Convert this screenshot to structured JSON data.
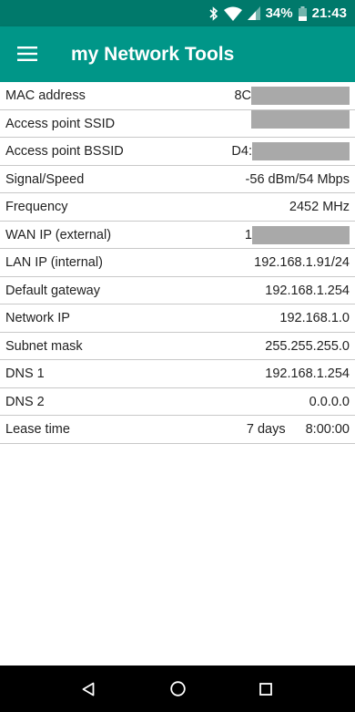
{
  "status_bar": {
    "battery": "34%",
    "time": "21:43",
    "icons": [
      "bluetooth-icon",
      "wifi-icon",
      "cell-signal-icon",
      "battery-icon"
    ]
  },
  "app_bar": {
    "title": "my Network Tools",
    "menu_icon": "hamburger-menu-icon"
  },
  "rows": [
    {
      "label": "MAC address",
      "value": "8C",
      "redacted": true
    },
    {
      "label": "Access point SSID",
      "value": "",
      "redacted": true
    },
    {
      "label": "Access point BSSID",
      "value": "D4:",
      "redacted": true
    },
    {
      "label": "Signal/Speed",
      "value": "-56 dBm/54 Mbps"
    },
    {
      "label": "Frequency",
      "value": "2452 MHz"
    },
    {
      "label": "WAN IP (external)",
      "value": "1",
      "redacted": true
    },
    {
      "label": "LAN IP (internal)",
      "value": "192.168.1.91/24"
    },
    {
      "label": "Default gateway",
      "value": "192.168.1.254"
    },
    {
      "label": "Network IP",
      "value": "192.168.1.0"
    },
    {
      "label": "Subnet mask",
      "value": "255.255.255.0"
    },
    {
      "label": "DNS 1",
      "value": "192.168.1.254"
    },
    {
      "label": "DNS 2",
      "value": "0.0.0.0"
    },
    {
      "label": "Lease time",
      "value": "7 days",
      "value2": "8:00:00"
    }
  ],
  "nav_bar": {
    "icons": [
      "back-icon",
      "home-icon",
      "recents-icon"
    ]
  },
  "colors": {
    "status_bar": "#00796b",
    "app_bar": "#009688",
    "redaction": "#a9a9a9"
  }
}
